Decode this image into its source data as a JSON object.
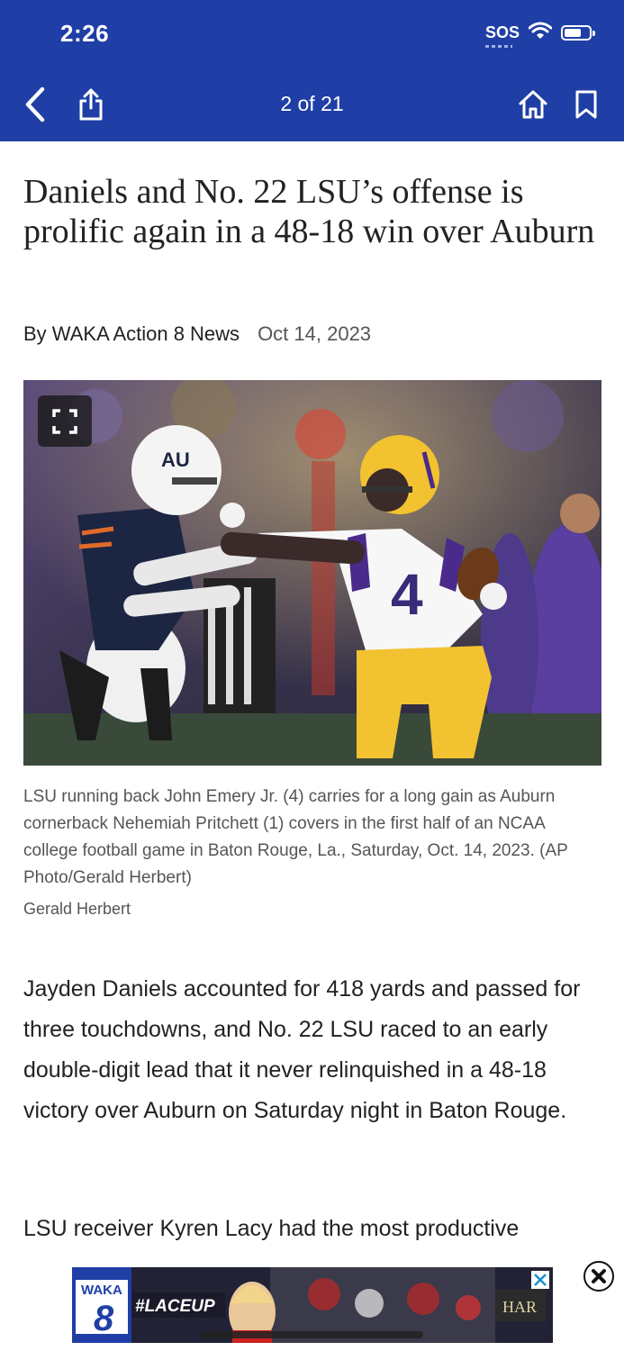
{
  "status_bar": {
    "time": "2:26",
    "sos": "SOS"
  },
  "nav": {
    "page_count": "2 of 21",
    "back_icon": "chevron-left-icon",
    "share_icon": "share-icon",
    "home_icon": "home-icon",
    "bookmark_icon": "bookmark-icon"
  },
  "article": {
    "headline": "Daniels and No. 22 LSU’s offense is prolific again in a 48-18 win over Auburn",
    "byline": "By WAKA Action 8 News",
    "date": "Oct 14, 2023",
    "photo": {
      "caption": "LSU running back John Emery Jr. (4) carries for a long gain as Auburn cornerback Nehemiah Pritchett (1) covers in the first half of an NCAA college football game in Baton Rouge, La., Saturday, Oct. 14, 2023. (AP Photo/Gerald Herbert)",
      "credit": "Gerald Herbert",
      "helmet_left": "AU",
      "jersey_number": "4"
    },
    "paragraphs": [
      "Jayden Daniels accounted for 418 yards and passed for three touchdowns, and No. 22 LSU raced to an early double-digit lead that it never relinquished in a 48-18 victory over Auburn on Saturday night in Baton Rouge.",
      "LSU receiver Kyren Lacy had the most productive"
    ]
  },
  "ad": {
    "brand": "WAKA",
    "channel": "8",
    "tagline": "#LACEUP",
    "sponsor": "HAR"
  },
  "colors": {
    "header_bg": "#1f3fa6",
    "lsu_gold": "#f2c230",
    "lsu_purple": "#4a2a8a",
    "auburn_navy": "#1c2541"
  }
}
